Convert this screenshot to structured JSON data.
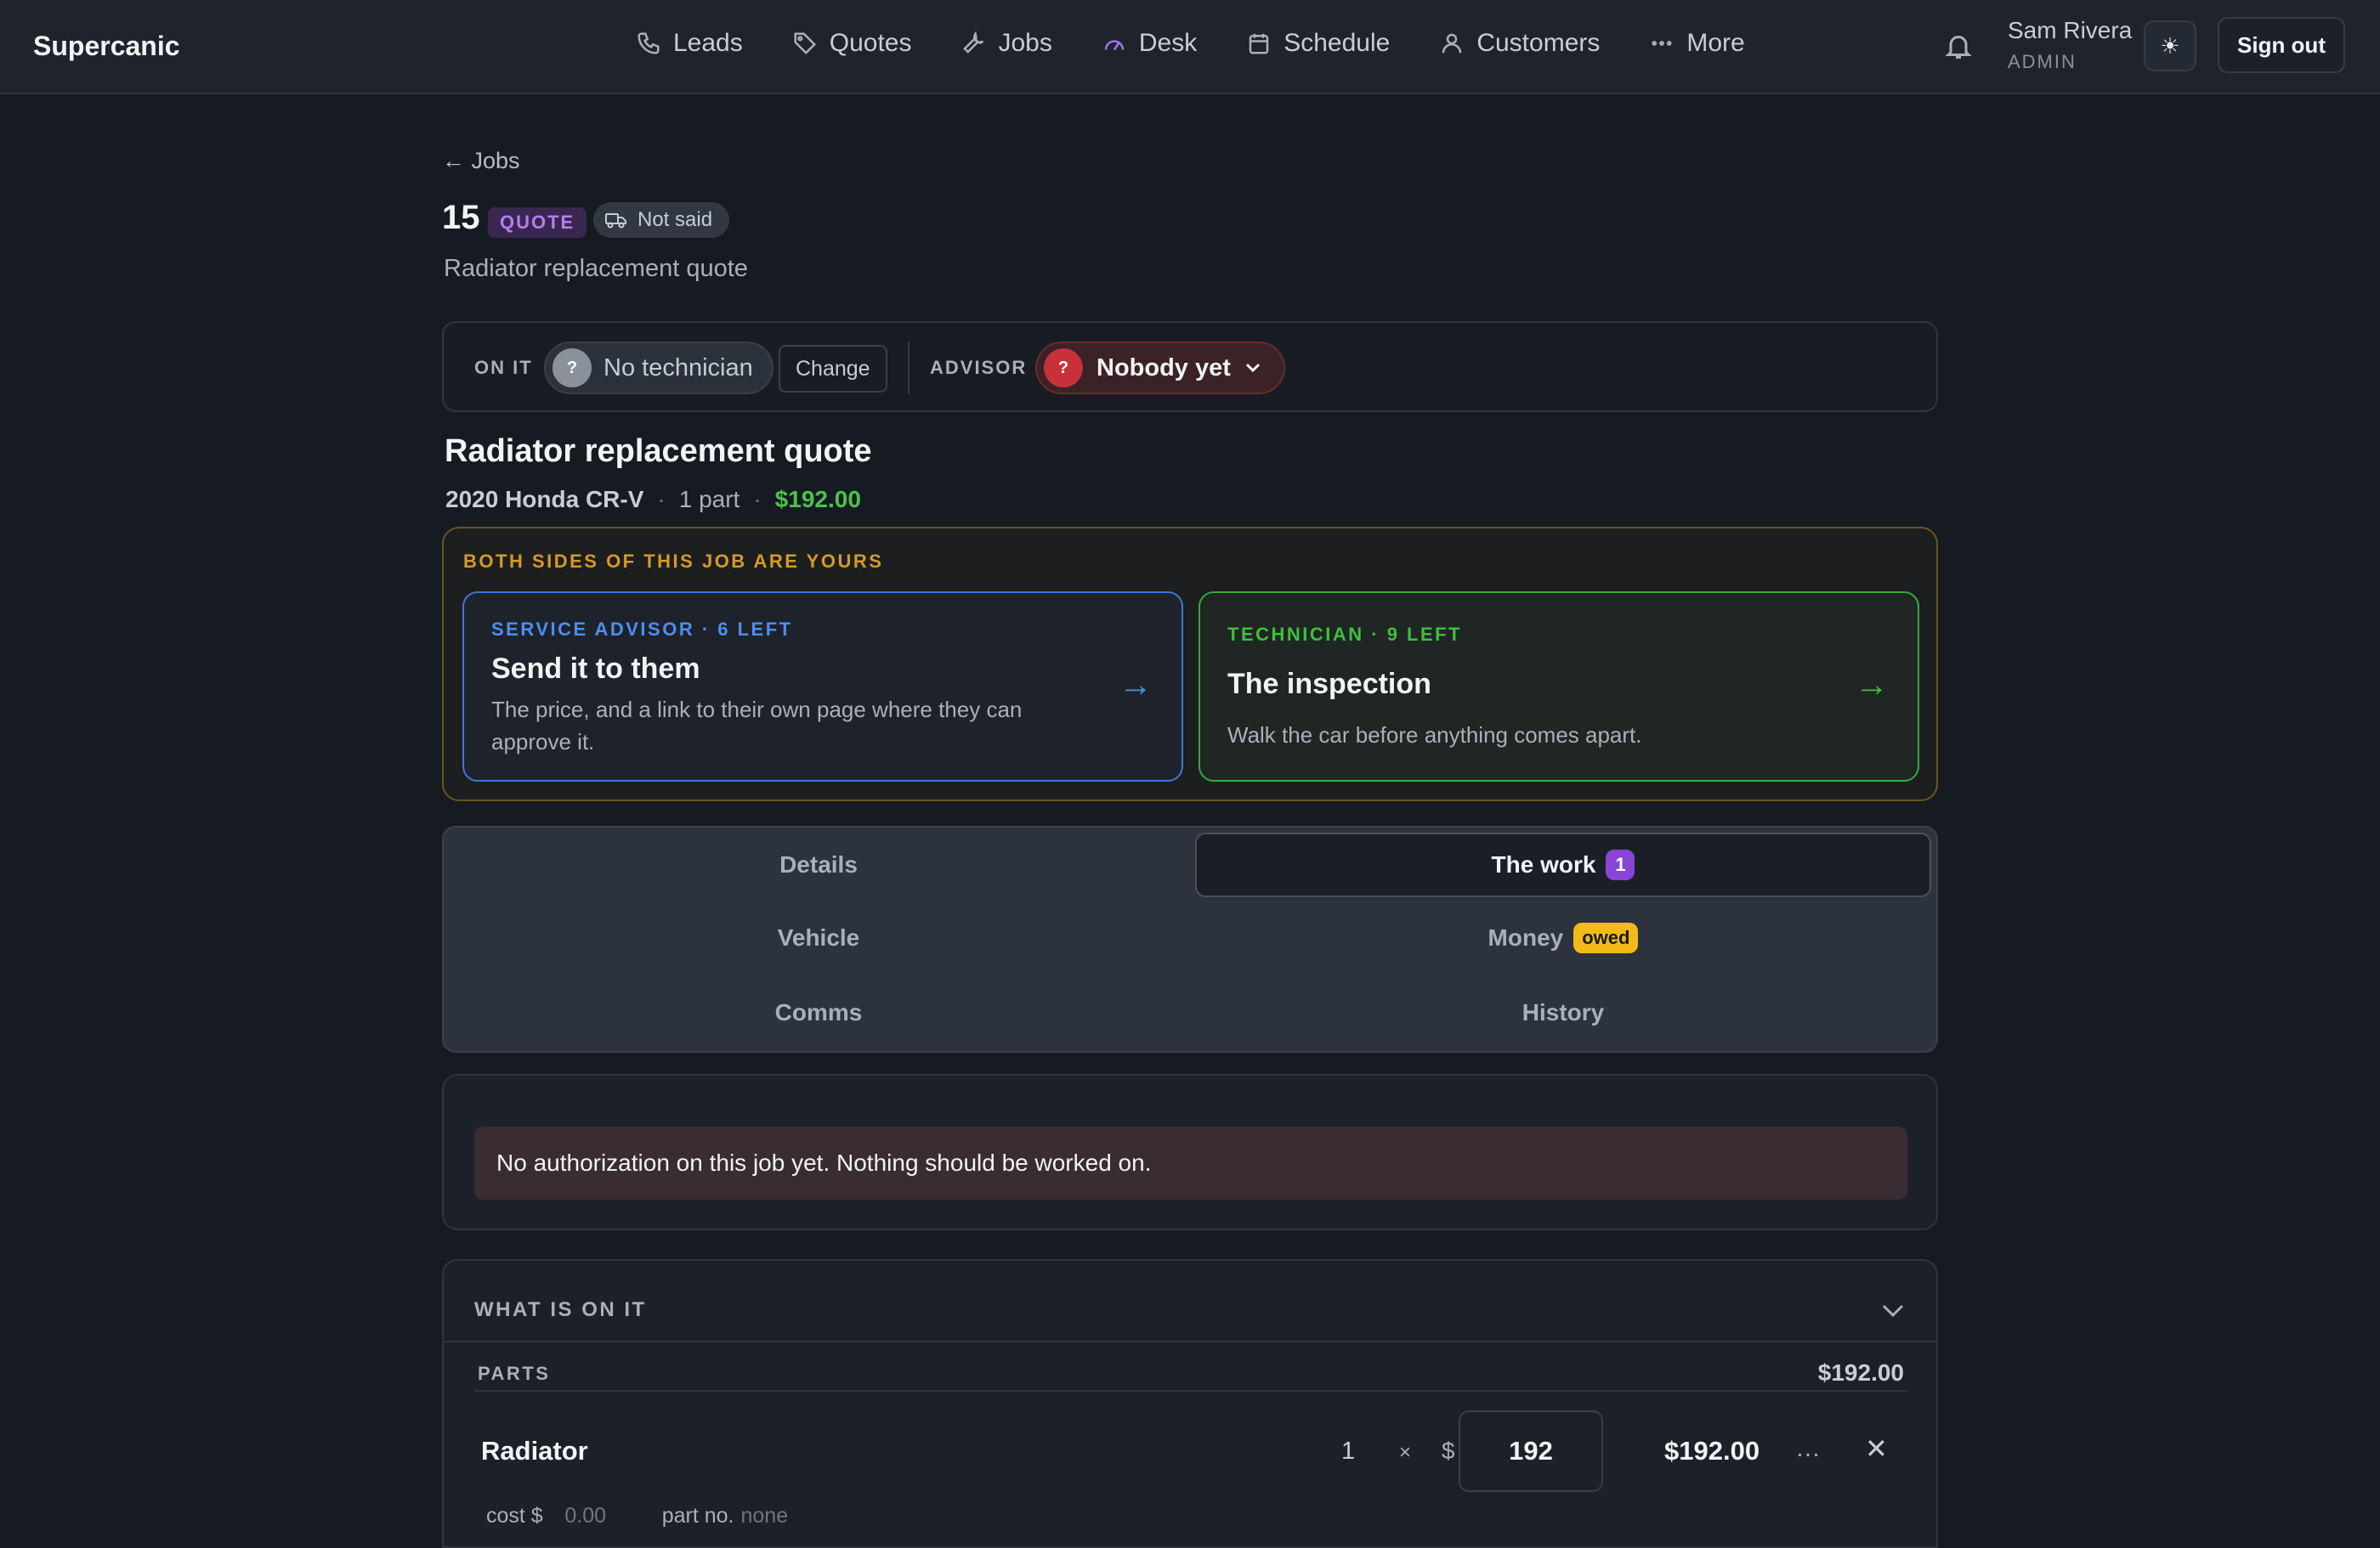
{
  "app": {
    "brand": "Supercanic"
  },
  "nav": {
    "items": [
      {
        "label": "Leads",
        "icon": "phone-icon"
      },
      {
        "label": "Quotes",
        "icon": "tag-icon"
      },
      {
        "label": "Jobs",
        "icon": "wrench-icon"
      },
      {
        "label": "Desk",
        "icon": "gauge-icon"
      },
      {
        "label": "Schedule",
        "icon": "calendar-icon"
      },
      {
        "label": "Customers",
        "icon": "user-icon"
      },
      {
        "label": "More",
        "icon": "more-dots-icon"
      }
    ],
    "user_name": "Sam Rivera",
    "user_role": "ADMIN",
    "theme_icon": "☀",
    "sign_out": "Sign out"
  },
  "job": {
    "back": "← Jobs",
    "number": "15",
    "status_badge": "QUOTE",
    "delivery_badge": "Not said",
    "subtitle": "Radiator replacement quote",
    "title": "Radiator replacement quote",
    "vehicle": "2020 Honda CR-V",
    "part_count": "1 part",
    "total": "$192.00",
    "separator": "·"
  },
  "assignment": {
    "on_it_label": "ON IT",
    "technician": "No technician",
    "technician_avatar": "?",
    "change": "Change",
    "advisor_label": "ADVISOR",
    "advisor": "Nobody yet",
    "advisor_avatar": "?"
  },
  "roles": {
    "label": "BOTH SIDES OF THIS JOB ARE YOURS",
    "advisor_card": {
      "kicker": "SERVICE ADVISOR · 6 LEFT",
      "title": "Send it to them",
      "desc": "The price, and a link to their own page where they can approve it.",
      "arrow": "→"
    },
    "tech_card": {
      "kicker": "TECHNICIAN · 9 LEFT",
      "title": "The inspection",
      "desc": "Walk the car before anything comes apart.",
      "arrow": "→"
    }
  },
  "tabs": {
    "details": "Details",
    "work": "The work",
    "work_count": "1",
    "vehicle": "Vehicle",
    "money": "Money",
    "money_badge": "owed",
    "comms": "Comms",
    "history": "History"
  },
  "auth": {
    "message": "No authorization on this job yet. Nothing should be worked on."
  },
  "items": {
    "heading": "WHAT IS ON IT",
    "parts_label": "PARTS",
    "parts_total": "$192.00",
    "part": {
      "name": "Radiator",
      "qty": "1",
      "times": "×",
      "currency": "$",
      "unit_price": "192",
      "line_total": "$192.00",
      "more": "…",
      "remove": "✕",
      "cost_label": "cost $",
      "cost_placeholder": "0.00",
      "part_no_label": "part no.",
      "part_no_placeholder": "none"
    }
  },
  "colors": {
    "background": "#161b22",
    "advisor_accent": "#4d8ef0",
    "tech_accent": "#3fbf3f",
    "warning_accent": "#d49a2a",
    "quote_purple": "#b67ef0",
    "money_green": "#4cc24a",
    "owed_yellow": "#f2bb1a",
    "danger_red": "#c8313a"
  }
}
